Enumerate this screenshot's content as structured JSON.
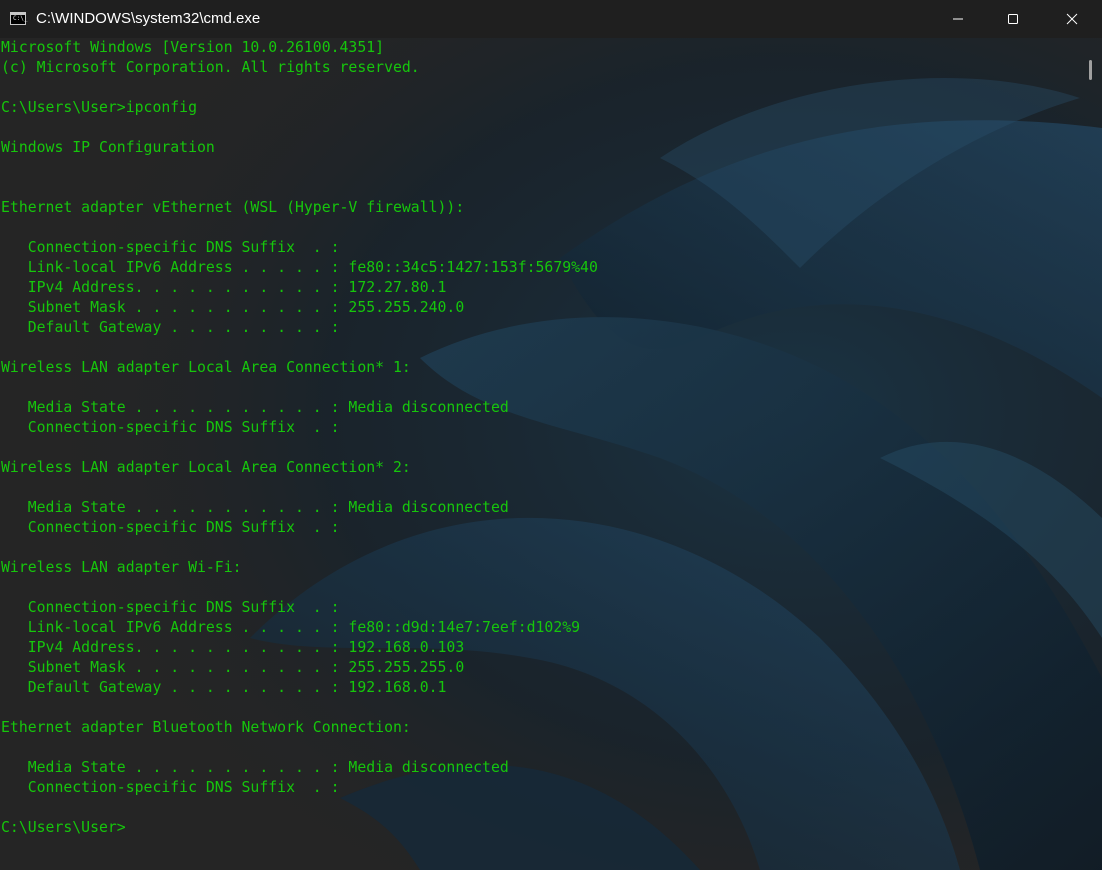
{
  "window": {
    "title": "C:\\WINDOWS\\system32\\cmd.exe",
    "icon": "console-app-icon",
    "icon_text": "C:\\_",
    "controls": [
      "minimize-icon",
      "maximize-icon",
      "close-icon"
    ]
  },
  "colors": {
    "terminal_text": "#16c60c",
    "titlebar": "#1f1f1f",
    "background": "#252525",
    "wallpaper_accent": "#1d3a4f"
  },
  "console": {
    "lines": [
      "Microsoft Windows [Version 10.0.26100.4351]",
      "(c) Microsoft Corporation. All rights reserved.",
      "",
      "C:\\Users\\User>ipconfig",
      "",
      "Windows IP Configuration",
      "",
      "",
      "Ethernet adapter vEthernet (WSL (Hyper-V firewall)):",
      "",
      "   Connection-specific DNS Suffix  . :",
      "   Link-local IPv6 Address . . . . . : fe80::34c5:1427:153f:5679%40",
      "   IPv4 Address. . . . . . . . . . . : 172.27.80.1",
      "   Subnet Mask . . . . . . . . . . . : 255.255.240.0",
      "   Default Gateway . . . . . . . . . :",
      "",
      "Wireless LAN adapter Local Area Connection* 1:",
      "",
      "   Media State . . . . . . . . . . . : Media disconnected",
      "   Connection-specific DNS Suffix  . :",
      "",
      "Wireless LAN adapter Local Area Connection* 2:",
      "",
      "   Media State . . . . . . . . . . . : Media disconnected",
      "   Connection-specific DNS Suffix  . :",
      "",
      "Wireless LAN adapter Wi-Fi:",
      "",
      "   Connection-specific DNS Suffix  . :",
      "   Link-local IPv6 Address . . . . . : fe80::d9d:14e7:7eef:d102%9",
      "   IPv4 Address. . . . . . . . . . . : 192.168.0.103",
      "   Subnet Mask . . . . . . . . . . . : 255.255.255.0",
      "   Default Gateway . . . . . . . . . : 192.168.0.1",
      "",
      "Ethernet adapter Bluetooth Network Connection:",
      "",
      "   Media State . . . . . . . . . . . : Media disconnected",
      "   Connection-specific DNS Suffix  . :",
      "",
      "C:\\Users\\User>"
    ]
  }
}
